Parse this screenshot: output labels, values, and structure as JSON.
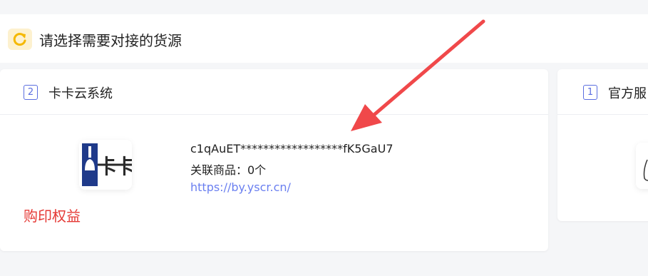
{
  "header": {
    "title": "请选择需要对接的货源",
    "icon": "refresh-icon",
    "icon_color": "#f5b800"
  },
  "cards": [
    {
      "index": "2",
      "name": "卡卡云系统",
      "logo_text": "卡卡云",
      "tag": "购印权益",
      "key": "c1qAuET******************fK5GaU7",
      "goods": "关联商品：0个",
      "url": "https://by.yscr.cn/"
    },
    {
      "index": "1",
      "name": "官方服"
    }
  ],
  "colors": {
    "accent": "#5b6ee0",
    "link": "#6a7ff0",
    "tag_red": "#e53935",
    "arrow_red": "#f0484a"
  }
}
